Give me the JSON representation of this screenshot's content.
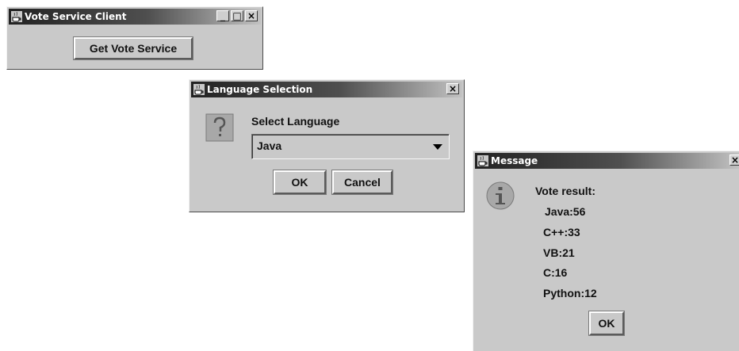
{
  "client_window": {
    "title": "Vote Service Client",
    "minimize_label": "_",
    "maximize_label": "□",
    "close_label": "×",
    "get_button_label": "Get Vote Service"
  },
  "language_dialog": {
    "title": "Language Selection",
    "close_label": "×",
    "icon": "question-icon",
    "prompt": "Select Language",
    "selected_language": "Java",
    "ok_label": "OK",
    "cancel_label": "Cancel"
  },
  "message_dialog": {
    "title": "Message",
    "close_label": "×",
    "icon": "information-icon",
    "heading": "Vote result:",
    "results": [
      "Java:56",
      "C++:33",
      "VB:21",
      "C:16",
      "Python:12"
    ],
    "ok_label": "OK"
  }
}
